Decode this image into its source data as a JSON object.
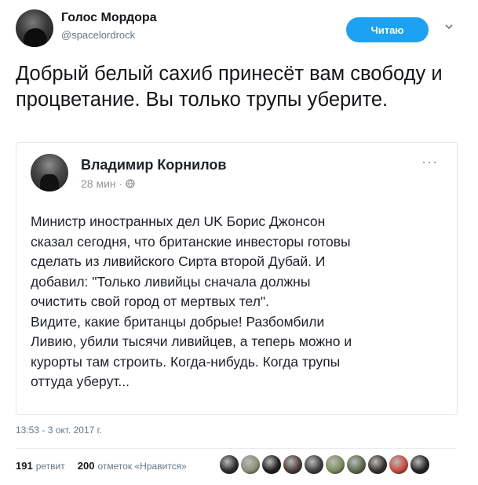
{
  "author": {
    "name": "Голос Мордора",
    "handle": "@spacelordrock"
  },
  "follow_button": {
    "label": "Читаю"
  },
  "tweet_text": "Добрый белый сахиб принесёт вам свободу и процветание. Вы только трупы уберите.",
  "embedded_post": {
    "author_name": "Владимир Корнилов",
    "time": "28 мин · ",
    "globe_icon": "globe-icon",
    "menu_label": "···",
    "body": "Министр иностранных дел UK Борис Джонсон\nсказал сегодня, что британские инвесторы готовы\nсделать из ливийского Сирта второй Дубай. И\nдобавил: \"Только ливийцы сначала должны\nочистить свой город от мертвых тел\".\nВидите, какие британцы добрые! Разбомбили\nЛивию, убили тысячи ливийцев, а теперь можно и\nкурорты там строить. Когда-нибудь. Когда трупы\nоттуда уберут..."
  },
  "timestamp": "13:53 - 3 окт. 2017 г.",
  "stats": {
    "retweets_count": "191",
    "retweets_label": "ретвит",
    "likes_count": "200",
    "likes_label": "отметок «Нравится»"
  },
  "liker_colors": [
    "#2b2b2b",
    "#8a8f7a",
    "#1e1e1e",
    "#4a3b36",
    "#3d3d3d",
    "#7c8a5a",
    "#5b6b4a",
    "#3a3030",
    "#c94a3a",
    "#222222"
  ],
  "colors": {
    "accent": "#1da1f2",
    "muted": "#657786"
  }
}
